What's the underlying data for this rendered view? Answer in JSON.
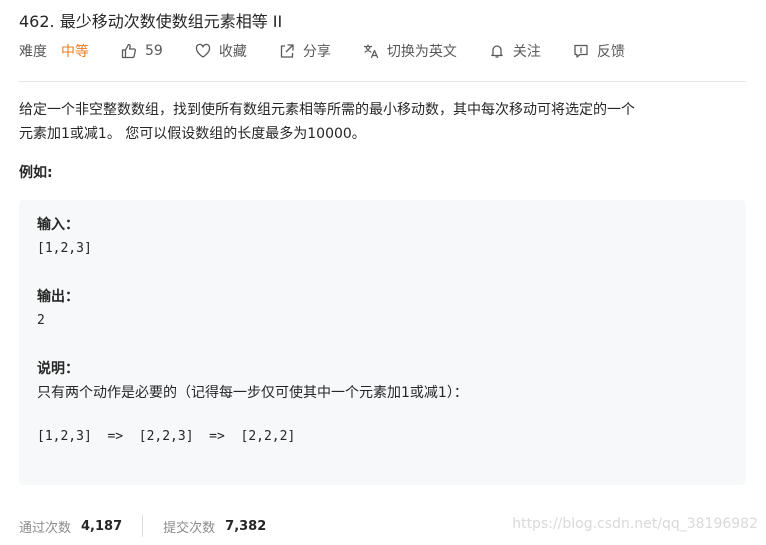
{
  "problem": {
    "title": "462. 最少移动次数使数组元素相等 II"
  },
  "meta": {
    "difficulty_label": "难度",
    "difficulty_value": "中等",
    "likes": "59",
    "collect_label": "收藏",
    "share_label": "分享",
    "translate_label": "切换为英文",
    "follow_label": "关注",
    "feedback_label": "反馈",
    "icons": [
      "thumbs-up-icon",
      "heart-icon",
      "share-icon",
      "translate-icon",
      "bell-icon",
      "feedback-icon"
    ],
    "difficulty_color": "#ef7c1f"
  },
  "description": {
    "line1": "给定一个非空整数数组，找到使所有数组元素相等所需的最小移动数，其中每次移动可将选定的一个",
    "line2": "元素加1或减1。 您可以假设数组的长度最多为10000。"
  },
  "example": {
    "heading": "例如:",
    "input_label": "输入：",
    "input_value": "[1,2,3]",
    "output_label": "输出：",
    "output_value": "2",
    "explain_label": "说明：",
    "explain_text": "只有两个动作是必要的（记得每一步仅可使其中一个元素加1或减1）：",
    "steps": "[1,2,3]  =>  [2,2,3]  =>  [2,2,2]"
  },
  "footer": {
    "accepted_label": "通过次数",
    "accepted_value": "4,187",
    "submitted_label": "提交次数",
    "submitted_value": "7,382"
  },
  "watermark": "https://blog.csdn.net/qq_38196982"
}
